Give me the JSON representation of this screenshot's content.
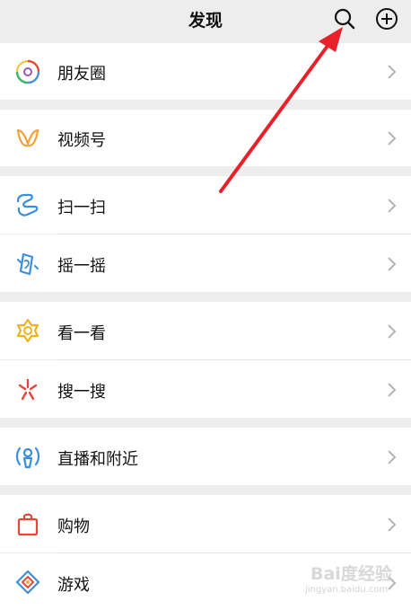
{
  "header": {
    "title": "发现",
    "search_icon": "search-icon",
    "add_icon": "plus-circle-icon"
  },
  "items": [
    {
      "label": "朋友圈",
      "icon": "moments-aperture-icon"
    },
    {
      "label": "视频号",
      "icon": "channels-butterfly-icon"
    },
    {
      "label": "扫一扫",
      "icon": "scan-icon"
    },
    {
      "label": "摇一摇",
      "icon": "shake-phone-icon"
    },
    {
      "label": "看一看",
      "icon": "top-stories-icon"
    },
    {
      "label": "搜一搜",
      "icon": "search-sparkle-icon"
    },
    {
      "label": "直播和附近",
      "icon": "live-nearby-icon"
    },
    {
      "label": "购物",
      "icon": "shopping-bag-icon"
    },
    {
      "label": "游戏",
      "icon": "game-diamond-icon"
    }
  ],
  "annotation": {
    "color": "#e8202a"
  },
  "watermark": {
    "main": "Bai度经验",
    "sub": "jingyan.baidu.com"
  },
  "colors": {
    "background": "#ededed",
    "row": "#ffffff",
    "text": "#111111"
  }
}
